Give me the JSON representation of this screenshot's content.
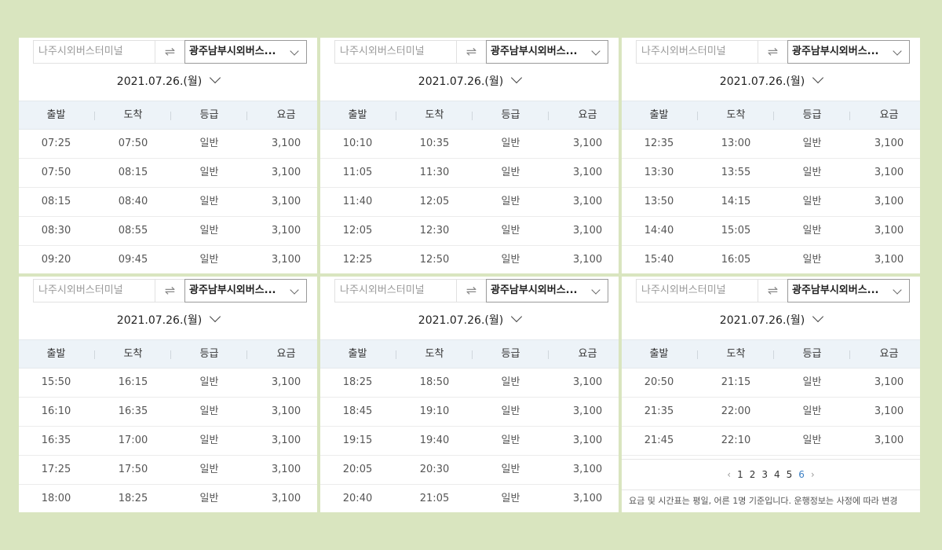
{
  "header_labels": {
    "depart": "출발",
    "arrive": "도착",
    "grade": "등급",
    "fare": "요금"
  },
  "swap_glyph": "⇌",
  "panels": [
    {
      "from_placeholder": "나주시외버스터미널",
      "to_value": "광주남부시외버스...",
      "date": "2021.07.26.(월)",
      "rows": [
        {
          "depart": "07:25",
          "arrive": "07:50",
          "grade": "일반",
          "fare": "3,100"
        },
        {
          "depart": "07:50",
          "arrive": "08:15",
          "grade": "일반",
          "fare": "3,100"
        },
        {
          "depart": "08:15",
          "arrive": "08:40",
          "grade": "일반",
          "fare": "3,100"
        },
        {
          "depart": "08:30",
          "arrive": "08:55",
          "grade": "일반",
          "fare": "3,100"
        },
        {
          "depart": "09:20",
          "arrive": "09:45",
          "grade": "일반",
          "fare": "3,100"
        }
      ]
    },
    {
      "from_placeholder": "나주시외버스터미널",
      "to_value": "광주남부시외버스...",
      "date": "2021.07.26.(월)",
      "rows": [
        {
          "depart": "10:10",
          "arrive": "10:35",
          "grade": "일반",
          "fare": "3,100"
        },
        {
          "depart": "11:05",
          "arrive": "11:30",
          "grade": "일반",
          "fare": "3,100"
        },
        {
          "depart": "11:40",
          "arrive": "12:05",
          "grade": "일반",
          "fare": "3,100"
        },
        {
          "depart": "12:05",
          "arrive": "12:30",
          "grade": "일반",
          "fare": "3,100"
        },
        {
          "depart": "12:25",
          "arrive": "12:50",
          "grade": "일반",
          "fare": "3,100"
        }
      ]
    },
    {
      "from_placeholder": "나주시외버스터미널",
      "to_value": "광주남부시외버스...",
      "date": "2021.07.26.(월)",
      "rows": [
        {
          "depart": "12:35",
          "arrive": "13:00",
          "grade": "일반",
          "fare": "3,100"
        },
        {
          "depart": "13:30",
          "arrive": "13:55",
          "grade": "일반",
          "fare": "3,100"
        },
        {
          "depart": "13:50",
          "arrive": "14:15",
          "grade": "일반",
          "fare": "3,100"
        },
        {
          "depart": "14:40",
          "arrive": "15:05",
          "grade": "일반",
          "fare": "3,100"
        },
        {
          "depart": "15:40",
          "arrive": "16:05",
          "grade": "일반",
          "fare": "3,100"
        }
      ]
    },
    {
      "from_placeholder": "나주시외버스터미널",
      "to_value": "광주남부시외버스...",
      "date": "2021.07.26.(월)",
      "rows": [
        {
          "depart": "15:50",
          "arrive": "16:15",
          "grade": "일반",
          "fare": "3,100"
        },
        {
          "depart": "16:10",
          "arrive": "16:35",
          "grade": "일반",
          "fare": "3,100"
        },
        {
          "depart": "16:35",
          "arrive": "17:00",
          "grade": "일반",
          "fare": "3,100"
        },
        {
          "depart": "17:25",
          "arrive": "17:50",
          "grade": "일반",
          "fare": "3,100"
        },
        {
          "depart": "18:00",
          "arrive": "18:25",
          "grade": "일반",
          "fare": "3,100"
        }
      ]
    },
    {
      "from_placeholder": "나주시외버스터미널",
      "to_value": "광주남부시외버스...",
      "date": "2021.07.26.(월)",
      "rows": [
        {
          "depart": "18:25",
          "arrive": "18:50",
          "grade": "일반",
          "fare": "3,100"
        },
        {
          "depart": "18:45",
          "arrive": "19:10",
          "grade": "일반",
          "fare": "3,100"
        },
        {
          "depart": "19:15",
          "arrive": "19:40",
          "grade": "일반",
          "fare": "3,100"
        },
        {
          "depart": "20:05",
          "arrive": "20:30",
          "grade": "일반",
          "fare": "3,100"
        },
        {
          "depart": "20:40",
          "arrive": "21:05",
          "grade": "일반",
          "fare": "3,100"
        }
      ]
    },
    {
      "from_placeholder": "나주시외버스터미널",
      "to_value": "광주남부시외버스...",
      "date": "2021.07.26.(월)",
      "rows": [
        {
          "depart": "20:50",
          "arrive": "21:15",
          "grade": "일반",
          "fare": "3,100"
        },
        {
          "depart": "21:35",
          "arrive": "22:00",
          "grade": "일반",
          "fare": "3,100"
        },
        {
          "depart": "21:45",
          "arrive": "22:10",
          "grade": "일반",
          "fare": "3,100"
        }
      ],
      "pagination": {
        "prev": "‹",
        "next": "›",
        "pages": [
          "1",
          "2",
          "3",
          "4",
          "5",
          "6"
        ],
        "current": "6"
      },
      "notice": "요금 및 시간표는 평일, 어른 1명 기준입니다. 운행정보는 사정에 따라 변경"
    }
  ]
}
